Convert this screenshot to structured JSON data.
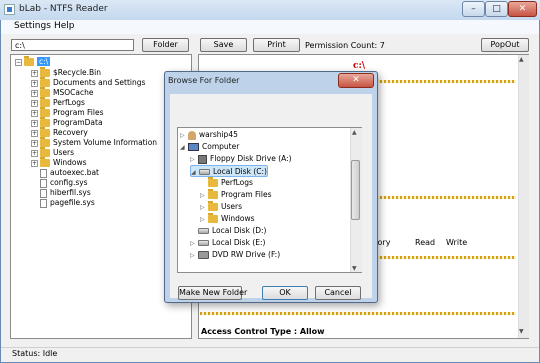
{
  "window": {
    "title": "bLab - NTFS Reader",
    "min_glyph": "–",
    "max_glyph": "□",
    "close_glyph": "✕"
  },
  "menu": {
    "settings": "Settings",
    "help": "Help"
  },
  "toolbar": {
    "path_value": "c:\\",
    "folder_label": "Folder",
    "save_label": "Save",
    "print_label": "Print",
    "permission_count": "Permission Count: 7",
    "popout_label": "PopOut"
  },
  "tree": {
    "root": "c:\\",
    "folders": [
      "$Recycle.Bin",
      "Documents and Settings",
      "MSOCache",
      "PerfLogs",
      "Program Files",
      "ProgramData",
      "Recovery",
      "System Volume Information",
      "Users",
      "Windows"
    ],
    "files": [
      "autoexec.bat",
      "config.sys",
      "hiberfil.sys",
      "pagefile.sys"
    ]
  },
  "content": {
    "heading": "c:\\",
    "column_partial": "ctory",
    "col_read": "Read",
    "col_write": "Write",
    "ace_type": "Access Control Type : Allow"
  },
  "dialog": {
    "title": "Browse For Folder",
    "close_glyph": "✕",
    "tree": [
      {
        "label": "warship45",
        "icon": "user-icon",
        "level": 0,
        "arrow": "▷"
      },
      {
        "label": "Computer",
        "icon": "computer-icon",
        "level": 0,
        "arrow": "◢"
      },
      {
        "label": "Floppy Disk Drive (A:)",
        "icon": "floppy-icon",
        "level": 1,
        "arrow": "▷"
      },
      {
        "label": "Local Disk (C:)",
        "icon": "drive-icon",
        "level": 1,
        "arrow": "◢",
        "selected": true
      },
      {
        "label": "PerfLogs",
        "icon": "folder-icon",
        "level": 2,
        "arrow": ""
      },
      {
        "label": "Program Files",
        "icon": "folder-icon",
        "level": 2,
        "arrow": "▷"
      },
      {
        "label": "Users",
        "icon": "folder-icon",
        "level": 2,
        "arrow": "▷"
      },
      {
        "label": "Windows",
        "icon": "folder-icon",
        "level": 2,
        "arrow": "▷"
      },
      {
        "label": "Local Disk (D:)",
        "icon": "drive-icon",
        "level": 1,
        "arrow": ""
      },
      {
        "label": "Local Disk (E:)",
        "icon": "drive-icon",
        "level": 1,
        "arrow": "▷"
      },
      {
        "label": "DVD RW Drive (F:)",
        "icon": "dvd-icon",
        "level": 1,
        "arrow": "▷"
      }
    ],
    "make_folder_label": "Make New Folder",
    "ok_label": "OK",
    "cancel_label": "Cancel"
  },
  "status": {
    "text": "Status: Idle"
  }
}
